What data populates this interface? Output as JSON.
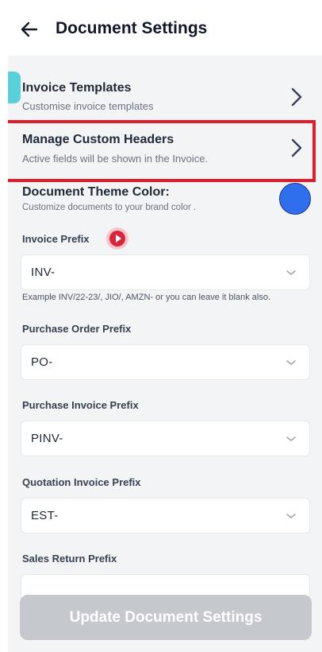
{
  "header": {
    "title": "Document Settings"
  },
  "templates": {
    "title": "Invoice Templates",
    "subtitle": "Customise invoice templates"
  },
  "custom_headers": {
    "title": "Manage Custom Headers",
    "subtitle": "Active fields will be shown in the Invoice."
  },
  "theme": {
    "title": "Document Theme Color:",
    "subtitle": "Customize documents to your brand color .",
    "color": "#2f6fed"
  },
  "invoice_prefix": {
    "label": "Invoice Prefix",
    "value": "INV-",
    "example": "Example INV/22-23/, JIO/, AMZN- or you can leave it blank also."
  },
  "purchase_order_prefix": {
    "label": "Purchase Order Prefix",
    "value": "PO-"
  },
  "purchase_invoice_prefix": {
    "label": "Purchase Invoice Prefix",
    "value": "PINV-"
  },
  "quotation_invoice_prefix": {
    "label": "Quotation Invoice Prefix",
    "value": "EST-"
  },
  "sales_return_prefix": {
    "label": "Sales Return Prefix",
    "value": ""
  },
  "update_button": {
    "label": "Update Document Settings"
  },
  "colors": {
    "highlight": "#e11d2a",
    "accent_play": "#d7263d",
    "button_disabled": "#c5c8cd"
  }
}
